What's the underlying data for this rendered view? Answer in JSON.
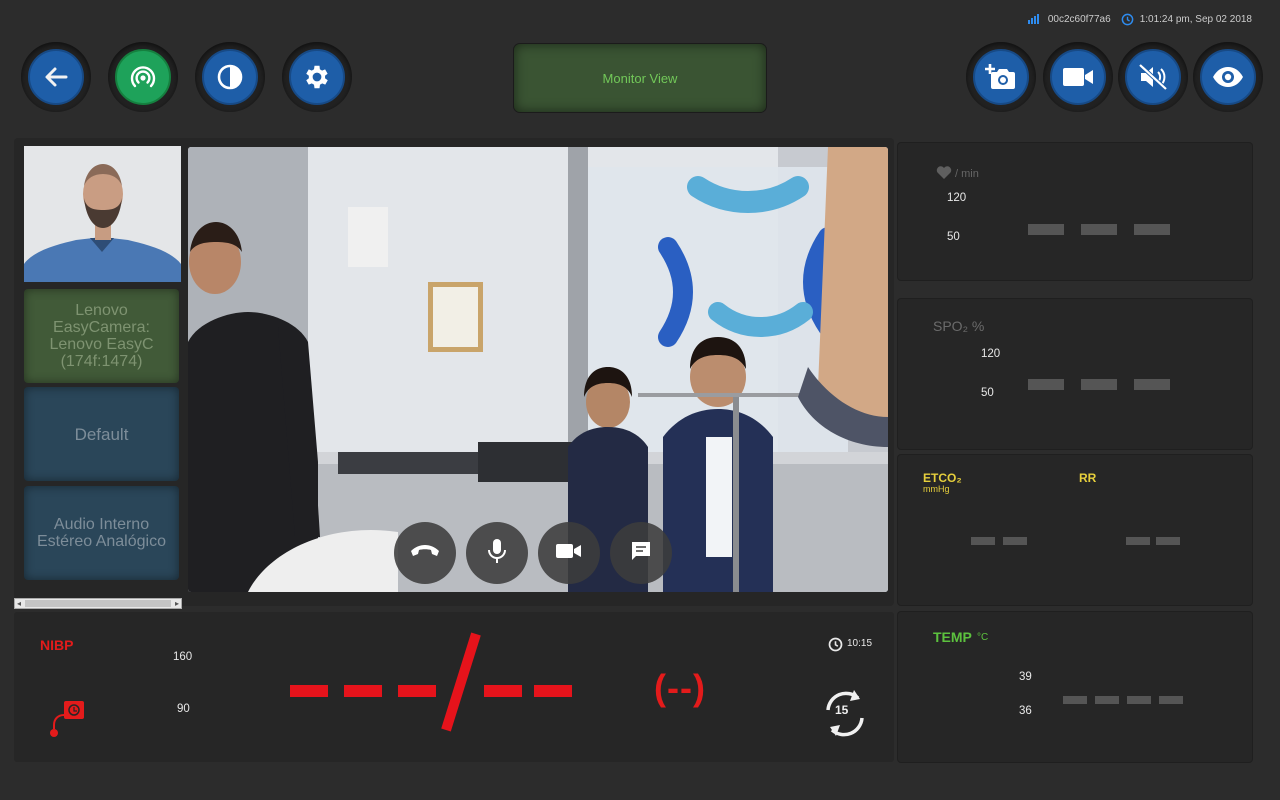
{
  "status": {
    "device_id": "00c2c60f77a6",
    "datetime": "1:01:24 pm, Sep 02 2018",
    "signal_icon": "signal-bars-icon",
    "clock_icon": "clock-icon"
  },
  "toolbar": {
    "left_buttons": [
      {
        "icon": "back-arrow-icon",
        "color": "#1e5ea8"
      },
      {
        "icon": "broadcast-icon",
        "color": "#1ea25a"
      },
      {
        "icon": "contrast-icon",
        "color": "#1e5ea8"
      },
      {
        "icon": "gear-icon",
        "color": "#1e5ea8"
      }
    ],
    "monitor_view_label": "Monitor View",
    "right_buttons": [
      {
        "icon": "add-photo-icon"
      },
      {
        "icon": "video-camera-icon"
      },
      {
        "icon": "mute-icon"
      },
      {
        "icon": "eye-icon"
      }
    ]
  },
  "sidebar": {
    "camera_label": "Lenovo EasyCamera: Lenovo EasyC (174f:1474)",
    "audio_output_label": "Default",
    "audio_input_label": "Audio Interno Estéreo Analógico"
  },
  "call_controls": [
    {
      "icon": "hang-up-icon"
    },
    {
      "icon": "microphone-icon"
    },
    {
      "icon": "video-camera-icon"
    },
    {
      "icon": "chat-icon"
    }
  ],
  "vitals": {
    "heart_rate": {
      "unit": "/ min",
      "high": "120",
      "low": "50"
    },
    "spo2": {
      "label": "SPO₂ %",
      "high": "120",
      "low": "50"
    },
    "etco2": {
      "label": "ETCO₂",
      "unit": "mmHg",
      "rr_label": "RR"
    },
    "temp": {
      "label": "TEMP",
      "unit": "°C",
      "high": "39",
      "low": "36"
    }
  },
  "nibp": {
    "label": "NIBP",
    "high": "160",
    "low": "90",
    "mean": "(--)",
    "time": "10:15",
    "interval": "15"
  },
  "colors": {
    "accent_blue": "#1e5ea8",
    "accent_green": "#1ea25a",
    "alarm_red": "#e31b1b",
    "label_yellow": "#e6cf3c",
    "temp_green": "#5cc13e"
  }
}
